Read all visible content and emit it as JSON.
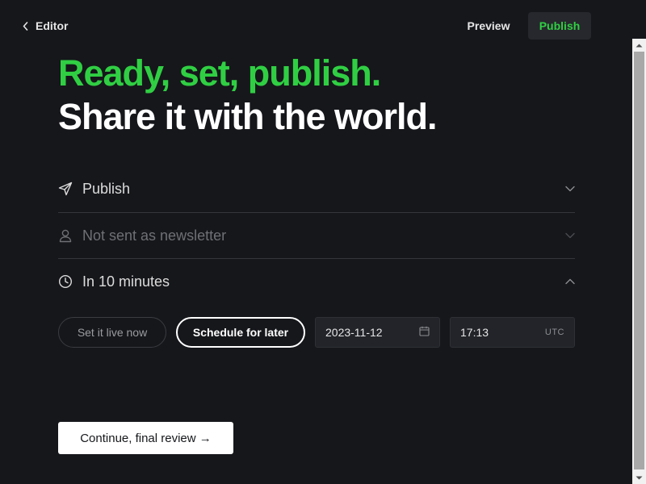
{
  "header": {
    "back_label": "Editor",
    "preview_label": "Preview",
    "publish_label": "Publish"
  },
  "headline": {
    "line1": "Ready, set, publish.",
    "line2": "Share it with the world."
  },
  "settings": {
    "publish_type": {
      "label": "Publish",
      "icon": "send-icon"
    },
    "email": {
      "label": "Not sent as newsletter",
      "icon": "person-icon"
    },
    "schedule": {
      "label": "In 10 minutes",
      "icon": "clock-icon"
    }
  },
  "schedule": {
    "now_label": "Set it live now",
    "later_label": "Schedule for later",
    "selected": "later",
    "date": "2023-11-12",
    "time": "17:13",
    "timezone": "UTC"
  },
  "footer": {
    "continue_label": "Continue, final review →"
  },
  "colors": {
    "background": "#16171b",
    "accent": "#30cf43",
    "muted_text": "#6e7075"
  }
}
